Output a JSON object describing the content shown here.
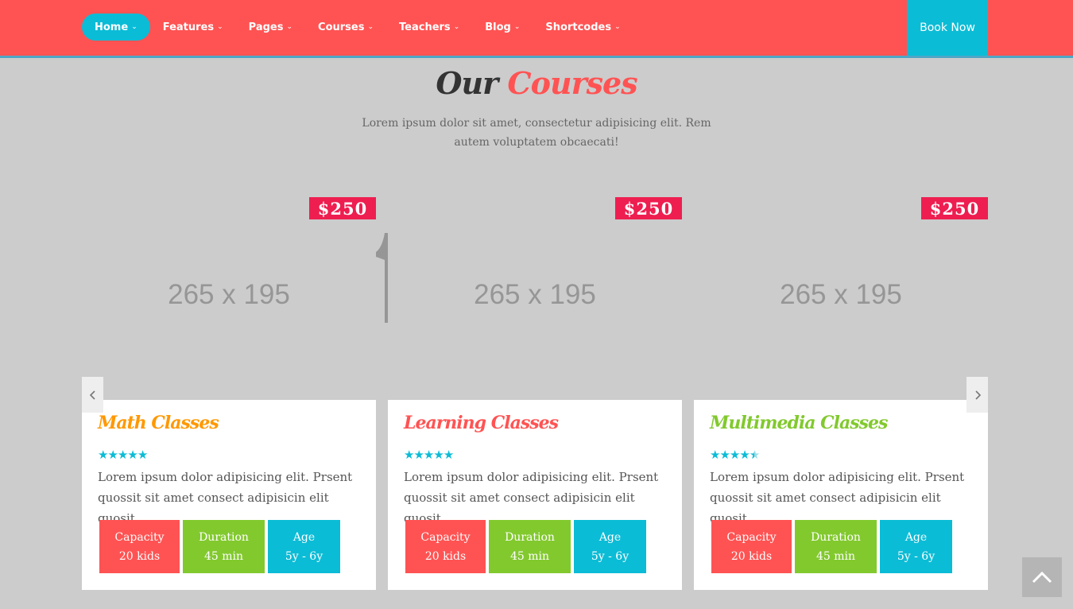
{
  "nav": {
    "items": [
      {
        "label": "Home"
      },
      {
        "label": "Features"
      },
      {
        "label": "Pages"
      },
      {
        "label": "Courses"
      },
      {
        "label": "Teachers"
      },
      {
        "label": "Blog"
      },
      {
        "label": "Shortcodes"
      }
    ],
    "book_now": "Book Now"
  },
  "section": {
    "title_plain": "Our",
    "title_accent": "Courses",
    "subtitle": "Lorem ipsum dolor sit amet, consectetur adipisicing elit. Rem autem voluptatem obcaecati!"
  },
  "colors": {
    "brand_red": "#ff5353",
    "cyan": "#0bbcd6",
    "green": "#82c92e",
    "price_pink": "#ee1e50"
  },
  "courses": [
    {
      "price": "$250",
      "image_placeholder": "265 x 195",
      "title": "Math Classes",
      "title_color": "#ff9800",
      "rating": 5,
      "description": "Lorem ipsum dolor adipisicing elit. Prsent quossit sit amet consect adipisicin elit quosit",
      "capacity_label": "Capacity",
      "capacity_value": "20 kids",
      "duration_label": "Duration",
      "duration_value": "45 min",
      "age_label": "Age",
      "age_value": "5y - 6y"
    },
    {
      "price": "$250",
      "image_placeholder": "265 x 195",
      "title": "Learning Classes",
      "title_color": "#ff5353",
      "rating": 5,
      "description": "Lorem ipsum dolor adipisicing elit. Prsent quossit sit amet consect adipisicin elit quosit",
      "capacity_label": "Capacity",
      "capacity_value": "20 kids",
      "duration_label": "Duration",
      "duration_value": "45 min",
      "age_label": "Age",
      "age_value": "5y - 6y"
    },
    {
      "price": "$250",
      "image_placeholder": "265 x 195",
      "title": "Multimedia Classes",
      "title_color": "#82c92e",
      "rating": 4.5,
      "description": "Lorem ipsum dolor adipisicing elit. Prsent quossit sit amet consect adipisicin elit quosit",
      "capacity_label": "Capacity",
      "capacity_value": "20 kids",
      "duration_label": "Duration",
      "duration_value": "45 min",
      "age_label": "Age",
      "age_value": "5y - 6y"
    }
  ],
  "icons": {
    "chevron": "chevron-down-icon",
    "prev": "chevron-left-icon",
    "next": "chevron-right-icon",
    "to_top": "chevron-up-icon",
    "star": "star-icon"
  }
}
